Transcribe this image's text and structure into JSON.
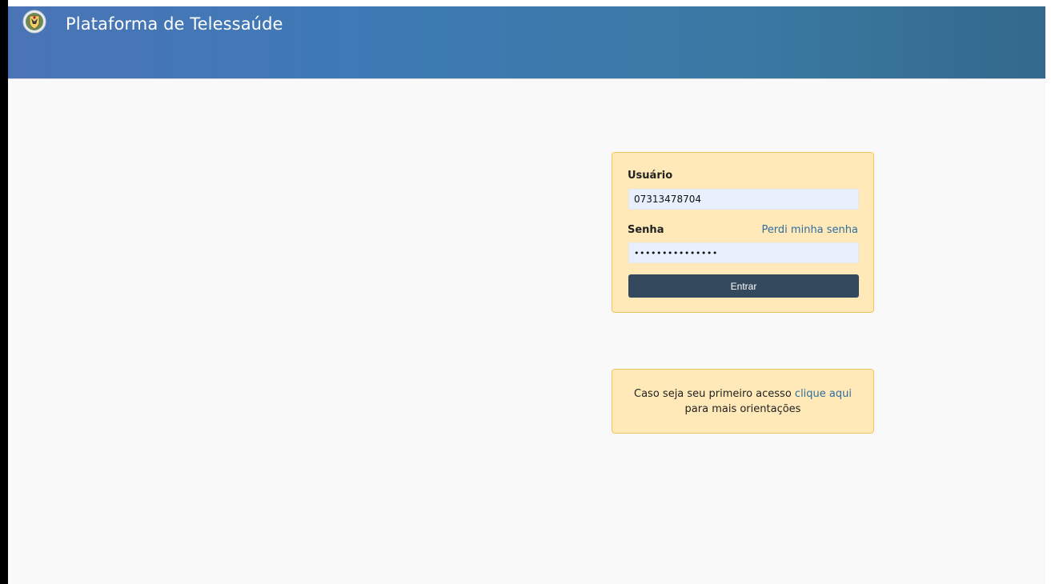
{
  "header": {
    "title": "Plataforma de Telessaúde",
    "logo_icon": "coat-of-arms-icon",
    "colors": {
      "gradient_start": "#4a74b6",
      "gradient_end": "#33698c"
    }
  },
  "login": {
    "username_label": "Usuário",
    "username_value": "07313478704",
    "password_label": "Senha",
    "password_value": "•••••••••••••••",
    "forgot_link": "Perdi minha senha",
    "submit_label": "Entrar",
    "colors": {
      "box_bg": "#ffe9b8",
      "box_border": "#f1c75d",
      "button_bg": "#34495e",
      "link": "#2f6d9f"
    }
  },
  "first_access": {
    "text_before": "Caso seja seu primeiro acesso ",
    "link_text": "clique aqui",
    "text_after": "para mais orientações"
  }
}
